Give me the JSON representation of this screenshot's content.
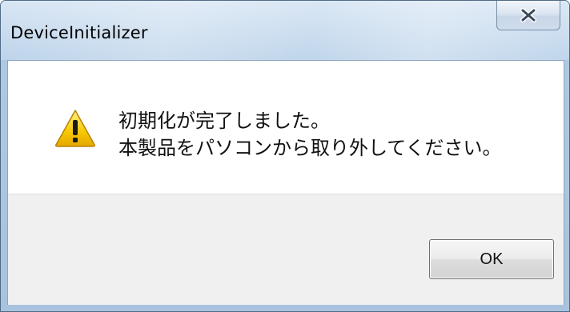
{
  "window": {
    "title": "DeviceInitializer"
  },
  "dialog": {
    "message_line1": "初期化が完了しました。",
    "message_line2": "本製品をパソコンから取り外してください。",
    "icon": "warning-icon"
  },
  "buttons": {
    "ok_label": "OK",
    "close_icon": "close-icon"
  },
  "colors": {
    "title_bar": "#bcd3ea",
    "footer": "#f0f0f0",
    "warning_yellow": "#f5c400"
  }
}
